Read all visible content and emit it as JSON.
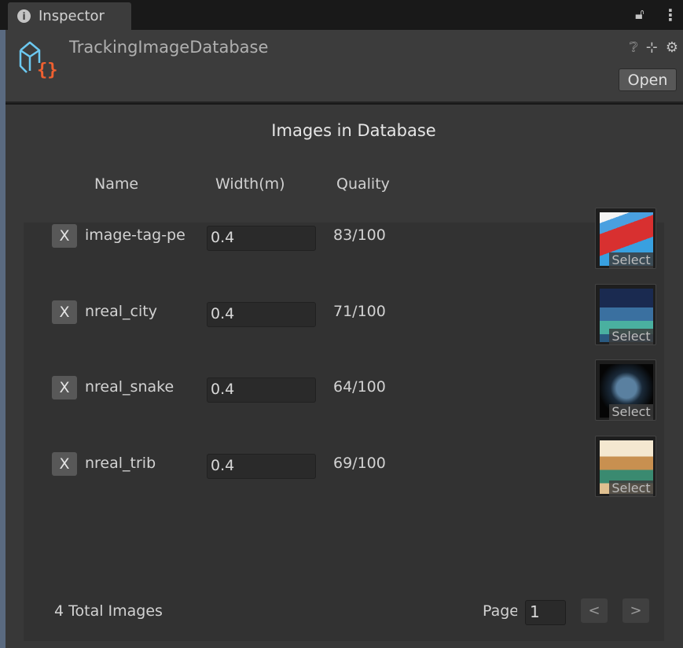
{
  "tab": {
    "label": "Inspector",
    "icon": "info-icon"
  },
  "tab_actions": {
    "lock": "lock-icon",
    "menu": "more-icon"
  },
  "asset": {
    "title": "TrackingImageDatabase",
    "open_label": "Open",
    "icon": "script-object-icon"
  },
  "header_icons": [
    "help-icon",
    "settings-sliders-icon",
    "gear-icon"
  ],
  "section_title": "Images in Database",
  "columns": {
    "name": "Name",
    "width": "Width(m)",
    "quality": "Quality"
  },
  "images": [
    {
      "remove": "X",
      "name": "image-tag-pe",
      "width": "0.4",
      "quality": "83/100",
      "select": "Select"
    },
    {
      "remove": "X",
      "name": "nreal_city",
      "width": "0.4",
      "quality": "71/100",
      "select": "Select"
    },
    {
      "remove": "X",
      "name": "nreal_snake",
      "width": "0.4",
      "quality": "64/100",
      "select": "Select"
    },
    {
      "remove": "X",
      "name": "nreal_trib",
      "width": "0.4",
      "quality": "69/100",
      "select": "Select"
    }
  ],
  "footer": {
    "total": "4 Total Images",
    "page_label": "Page",
    "page_value": "1",
    "prev": "<",
    "next": ">"
  }
}
